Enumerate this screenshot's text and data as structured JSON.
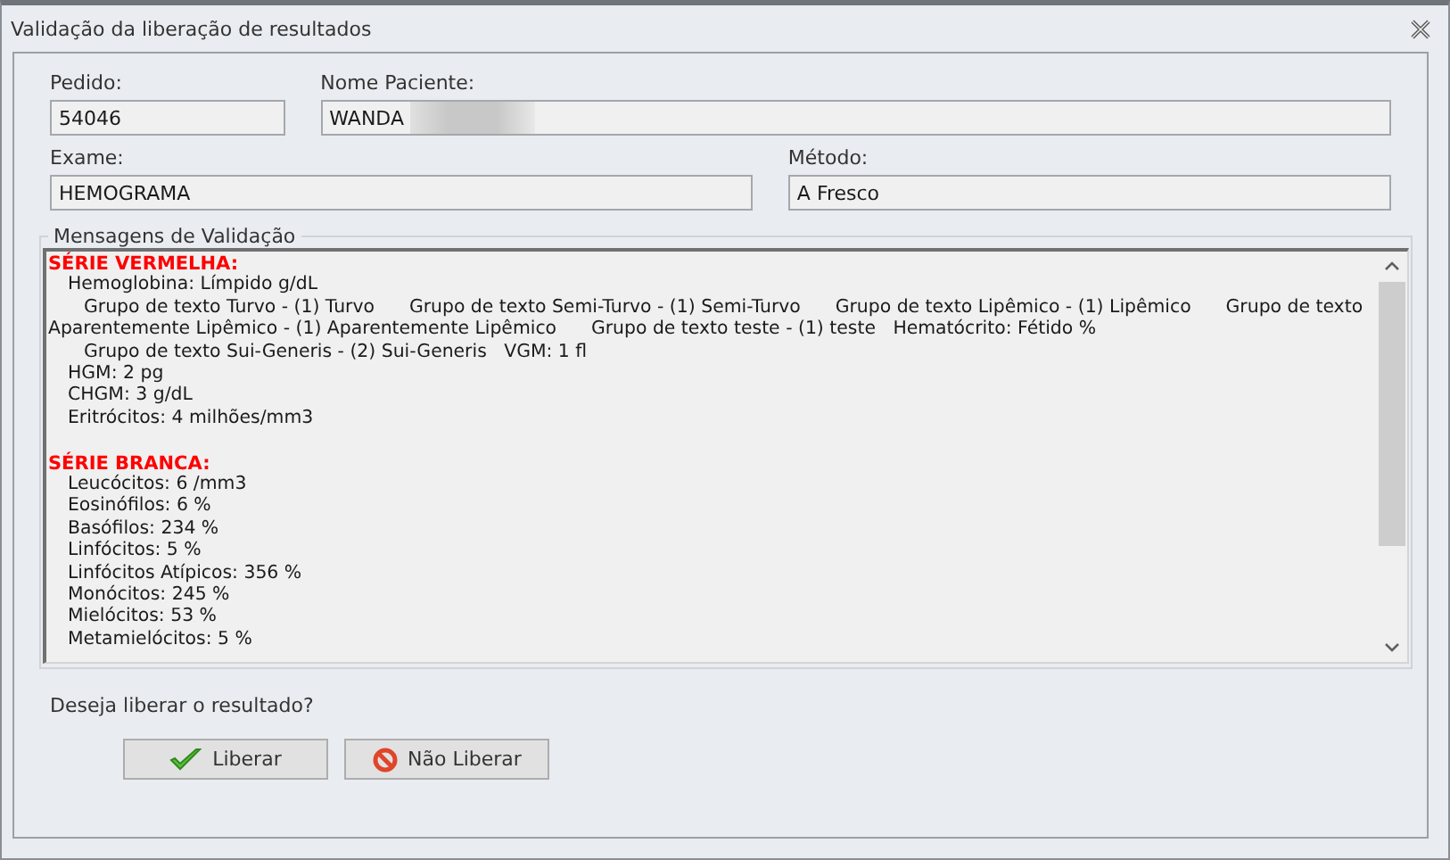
{
  "window": {
    "title": "Validação da liberação de resultados"
  },
  "fields": [
    {
      "label": "Pedido:",
      "value": "54046"
    },
    {
      "label": "Nome Paciente:",
      "value": "WANDA",
      "redacted": true
    },
    {
      "label": "Exame:",
      "value": "HEMOGRAMA"
    },
    {
      "label": "Método:",
      "value": "A Fresco"
    }
  ],
  "messages": {
    "title": "Mensagens de Validação",
    "sections": [
      {
        "heading": "SÉRIE VERMELHA:",
        "lines": [
          {
            "kind": "item",
            "text": "Hemoglobina: Límpido g/dL"
          },
          {
            "kind": "subitem",
            "text": "Grupo de texto Turvo - (1) Turvo      Grupo de texto Semi-Turvo - (1) Semi-Turvo      Grupo de texto Lipêmico - (1) Lipêmico      Grupo de texto"
          },
          {
            "kind": "wrap",
            "text": "Aparentemente Lipêmico - (1) Aparentemente Lipêmico      Grupo de texto teste - (1) teste   Hematócrito: Fétido %"
          },
          {
            "kind": "subitem",
            "text": "Grupo de texto Sui-Generis - (2) Sui-Generis   VGM: 1 fl"
          },
          {
            "kind": "item",
            "text": "HGM: 2 pg"
          },
          {
            "kind": "item",
            "text": "CHGM: 3 g/dL"
          },
          {
            "kind": "item",
            "text": "Eritrócitos: 4 milhões/mm3"
          }
        ]
      },
      {
        "heading": "SÉRIE BRANCA:",
        "lines": [
          {
            "kind": "item",
            "text": "Leucócitos: 6 /mm3"
          },
          {
            "kind": "item",
            "text": "Eosinófilos: 6 %"
          },
          {
            "kind": "item",
            "text": "Basófilos: 234 %"
          },
          {
            "kind": "item",
            "text": "Linfócitos: 5 %"
          },
          {
            "kind": "item",
            "text": "Linfócitos Atípicos: 356 %"
          },
          {
            "kind": "item",
            "text": "Monócitos: 245 %"
          },
          {
            "kind": "item",
            "text": "Mielócitos: 53 %"
          },
          {
            "kind": "item",
            "text": "Metamielócitos: 5 %"
          }
        ]
      }
    ]
  },
  "question": "Deseja liberar o resultado?",
  "buttons": [
    {
      "kind": "accept",
      "label": "Liberar"
    },
    {
      "kind": "reject",
      "label": "Não Liberar"
    }
  ]
}
